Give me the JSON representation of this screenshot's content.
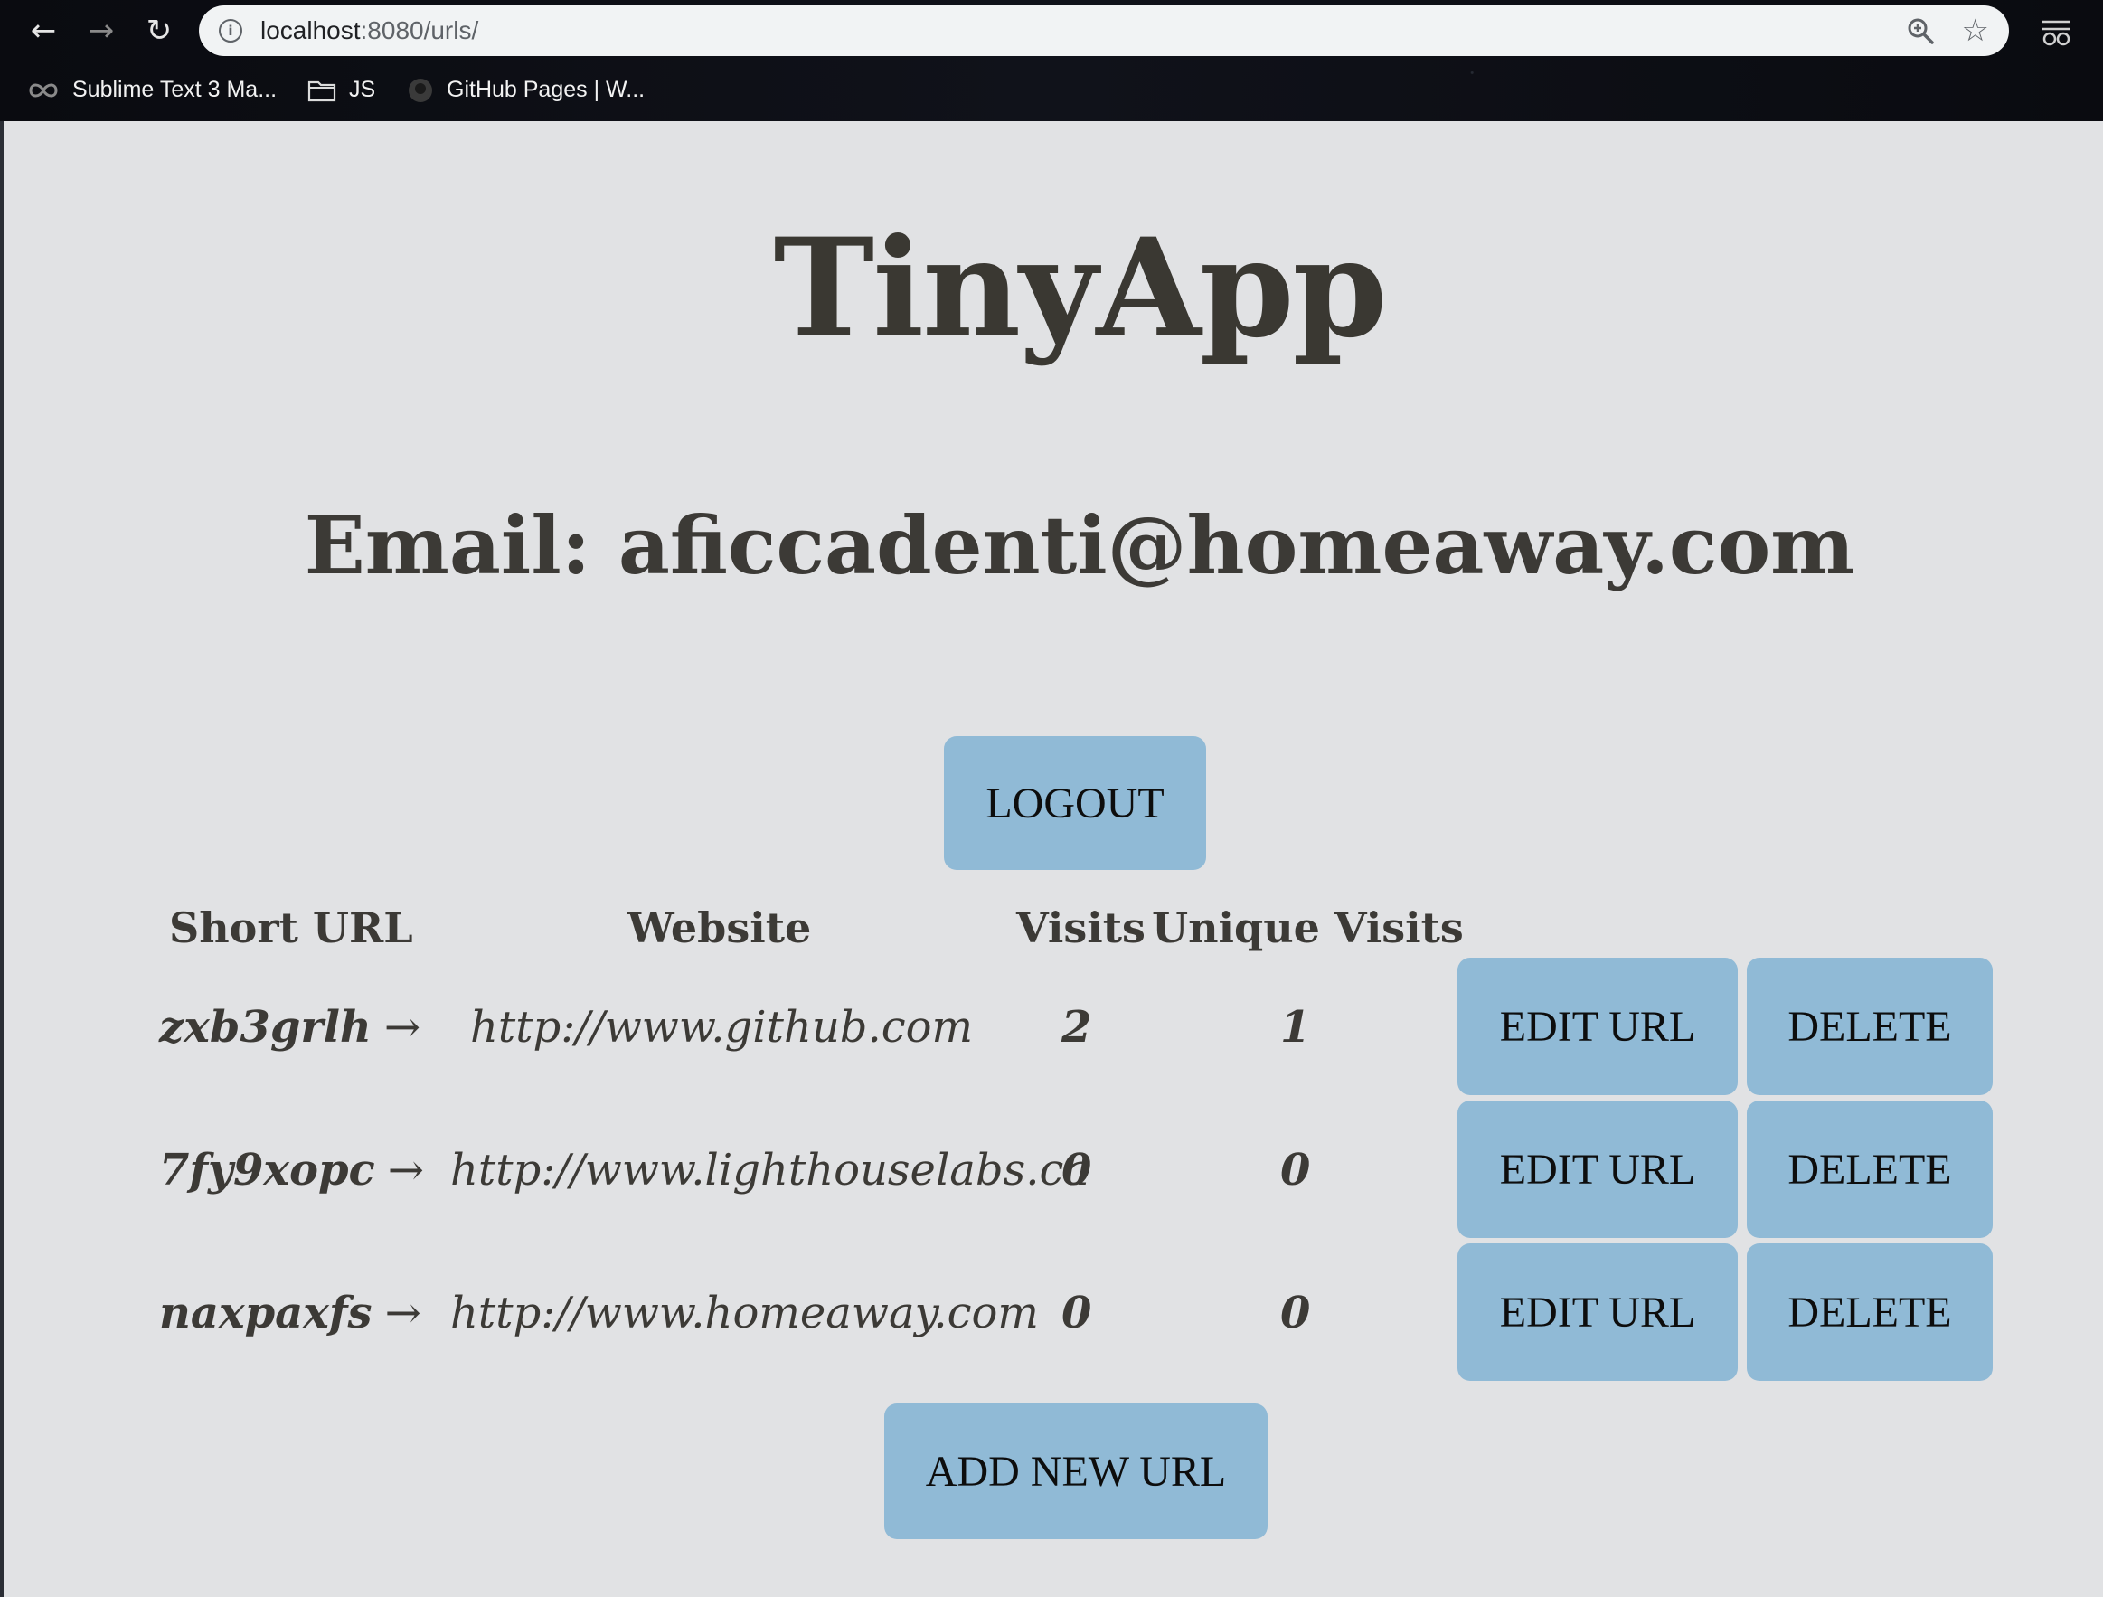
{
  "browser": {
    "url_host": "localhost",
    "url_rest": ":8080/urls/",
    "bookmarks": [
      {
        "label": "Sublime Text 3 Ma...",
        "icon": "infinity-icon"
      },
      {
        "label": "JS",
        "icon": "folder-icon"
      },
      {
        "label": "GitHub Pages | W...",
        "icon": "github-icon"
      }
    ]
  },
  "app": {
    "title": "TinyApp",
    "email_line": "Email: aficcadenti@homeaway.com",
    "logout_label": "LOGOUT",
    "add_new_label": "ADD NEW URL"
  },
  "table": {
    "headers": {
      "short_url": "Short URL",
      "website": "Website",
      "visits": "Visits",
      "unique_visits": "Unique Visits"
    },
    "arrow": "→",
    "edit_label": "EDIT URL",
    "delete_label": "DELETE",
    "rows": [
      {
        "short": "zxb3grlh",
        "website": "http://www.github.com",
        "visits": "2",
        "unique": "1"
      },
      {
        "short": "7fy9xopc",
        "website": "http://www.lighthouselabs.ca",
        "visits": "0",
        "unique": "0"
      },
      {
        "short": "naxpaxfs",
        "website": "http://www.homeaway.com",
        "visits": "0",
        "unique": "0"
      }
    ]
  },
  "colors": {
    "page_bg": "#e1e2e4",
    "button_bg": "#90bad6",
    "text_dark": "#3c3a36"
  }
}
